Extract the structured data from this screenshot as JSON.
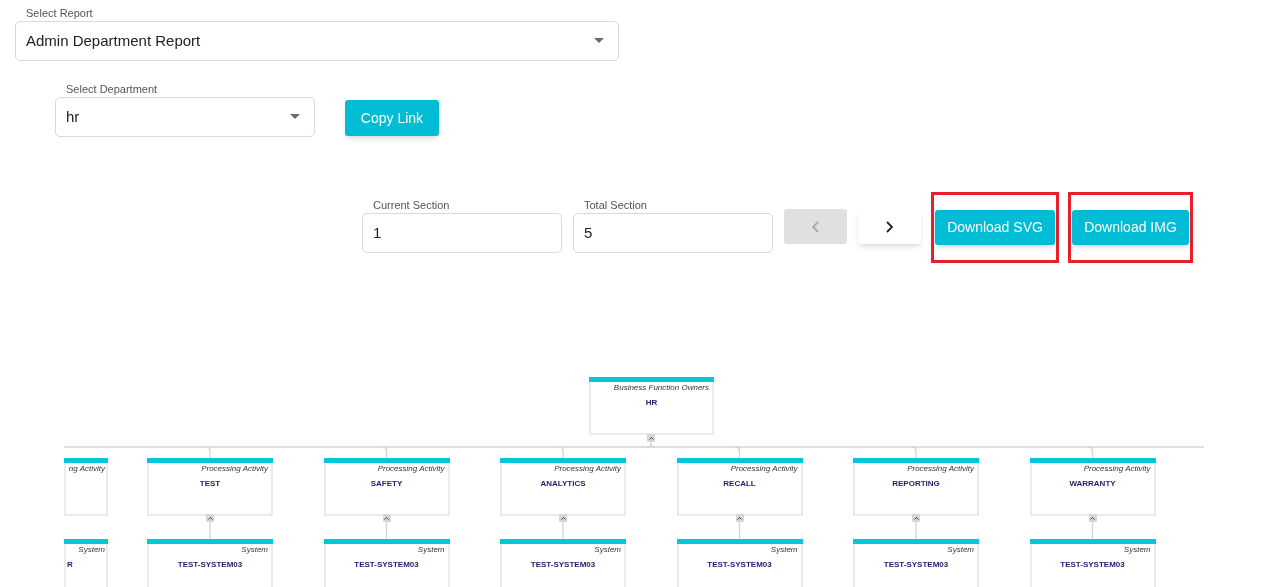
{
  "report_select": {
    "label": "Select Report",
    "value": "Admin Department Report"
  },
  "department_select": {
    "label": "Select Department",
    "value": "hr"
  },
  "copy_link_button": {
    "label": "Copy Link"
  },
  "pager": {
    "fields": [
      {
        "label": "Current Section",
        "value": "1"
      },
      {
        "label": "Total Section",
        "value": "5"
      }
    ],
    "buttons": [
      {
        "kind": "previous",
        "disabled": true
      },
      {
        "kind": "next",
        "disabled": false
      }
    ]
  },
  "download_buttons": [
    {
      "label": "Download SVG",
      "highlighted": true
    },
    {
      "label": "Download IMG",
      "highlighted": true
    }
  ],
  "org_chart": {
    "root": {
      "type": "Business Function Owners",
      "name": "HR",
      "expanded": true,
      "children": [
        {
          "type": "ng Activity",
          "partial": true,
          "children": [
            {
              "type": "System",
              "name": "R",
              "partial": true
            }
          ]
        },
        {
          "type": "Processing Activity",
          "name": "TEST",
          "expanded": true,
          "children": [
            {
              "type": "System",
              "name": "TEST-SYSTEM03"
            }
          ]
        },
        {
          "type": "Processing Activity",
          "name": "SAFETY",
          "expanded": true,
          "children": [
            {
              "type": "System",
              "name": "TEST-SYSTEM03"
            }
          ]
        },
        {
          "type": "Processing Activity",
          "name": "ANALYTICS",
          "expanded": true,
          "children": [
            {
              "type": "System",
              "name": "TEST-SYSTEM03"
            }
          ]
        },
        {
          "type": "Processing Activity",
          "name": "RECALL",
          "expanded": true,
          "children": [
            {
              "type": "System",
              "name": "TEST-SYSTEM03"
            }
          ]
        },
        {
          "type": "Processing Activity",
          "name": "REPORTING",
          "expanded": true,
          "children": [
            {
              "type": "System",
              "name": "TEST-SYSTEM03"
            }
          ]
        },
        {
          "type": "Processing Activity",
          "name": "WARRANTY",
          "expanded": true,
          "children": [
            {
              "type": "System",
              "name": "TEST-SYSTEM03"
            }
          ]
        }
      ]
    }
  }
}
